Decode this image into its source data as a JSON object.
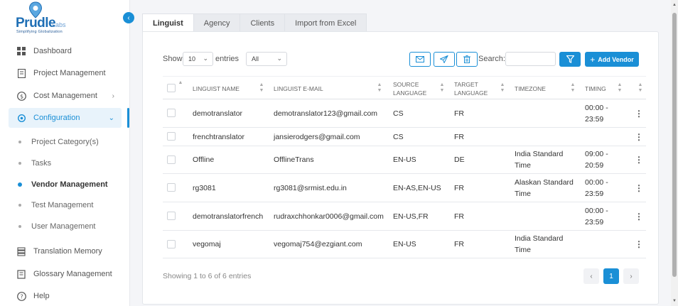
{
  "brand": {
    "name": "Prudle",
    "suffix": "Labs",
    "tagline": "Simplifying Globalization"
  },
  "sidebar": {
    "items": [
      {
        "label": "Dashboard",
        "icon": "grid-icon"
      },
      {
        "label": "Project Management",
        "icon": "document-icon"
      },
      {
        "label": "Cost Management",
        "icon": "dollar-circle-icon",
        "chevron": "›"
      },
      {
        "label": "Configuration",
        "icon": "gear-icon",
        "chevron": "⌄"
      }
    ],
    "sub_items": [
      {
        "label": "Project Category(s)"
      },
      {
        "label": "Tasks"
      },
      {
        "label": "Vendor Management"
      },
      {
        "label": "Test Management"
      },
      {
        "label": "User Management"
      }
    ],
    "bottom_items": [
      {
        "label": "Translation Memory",
        "icon": "database-icon"
      },
      {
        "label": "Glossary Management",
        "icon": "book-icon"
      },
      {
        "label": "Help",
        "icon": "help-circle-icon"
      }
    ]
  },
  "tabs": [
    {
      "label": "Linguist"
    },
    {
      "label": "Agency"
    },
    {
      "label": "Clients"
    },
    {
      "label": "Import from Excel"
    }
  ],
  "toolbar": {
    "show_label": "Show",
    "entries_value": "10",
    "entries_label": "entries",
    "filter_value": "All",
    "search_label": "Search:",
    "search_placeholder": "",
    "add_vendor_label": "Add Vendor"
  },
  "table": {
    "headers": {
      "name": "LINGUIST NAME",
      "email": "LINGUIST E-MAIL",
      "source": "SOURCE LANGUAGE",
      "target": "TARGET LANGUAGE",
      "timezone": "TIMEZONE",
      "timing": "TIMING"
    },
    "rows": [
      {
        "name": "demotranslator",
        "email": "demotranslator123@gmail.com",
        "source": "CS",
        "target": "FR",
        "timezone": "",
        "timing": "00:00 - 23:59"
      },
      {
        "name": "frenchtranslator",
        "email": "jansierodgers@gmail.com",
        "source": "CS",
        "target": "FR",
        "timezone": "",
        "timing": ""
      },
      {
        "name": "Offline",
        "email": "OfflineTrans",
        "source": "EN-US",
        "target": "DE",
        "timezone": "India Standard Time",
        "timing": "09:00 - 20:59"
      },
      {
        "name": "rg3081",
        "email": "rg3081@srmist.edu.in",
        "source": "EN-AS,EN-US",
        "target": "FR",
        "timezone": "Alaskan Standard Time",
        "timing": "00:00 - 23:59"
      },
      {
        "name": "demotranslatorfrench",
        "email": "rudraxchhonkar0006@gmail.com",
        "source": "EN-US,FR",
        "target": "FR",
        "timezone": "",
        "timing": "00:00 - 23:59"
      },
      {
        "name": "vegomaj",
        "email": "vegomaj754@ezgiant.com",
        "source": "EN-US",
        "target": "FR",
        "timezone": "India Standard Time",
        "timing": ""
      }
    ]
  },
  "footer": {
    "info": "Showing 1 to 6 of 6 entries",
    "current_page": "1",
    "prev": "‹",
    "next": "›"
  },
  "colors": {
    "accent": "#1a8fd6",
    "brand": "#1f6fb5"
  }
}
